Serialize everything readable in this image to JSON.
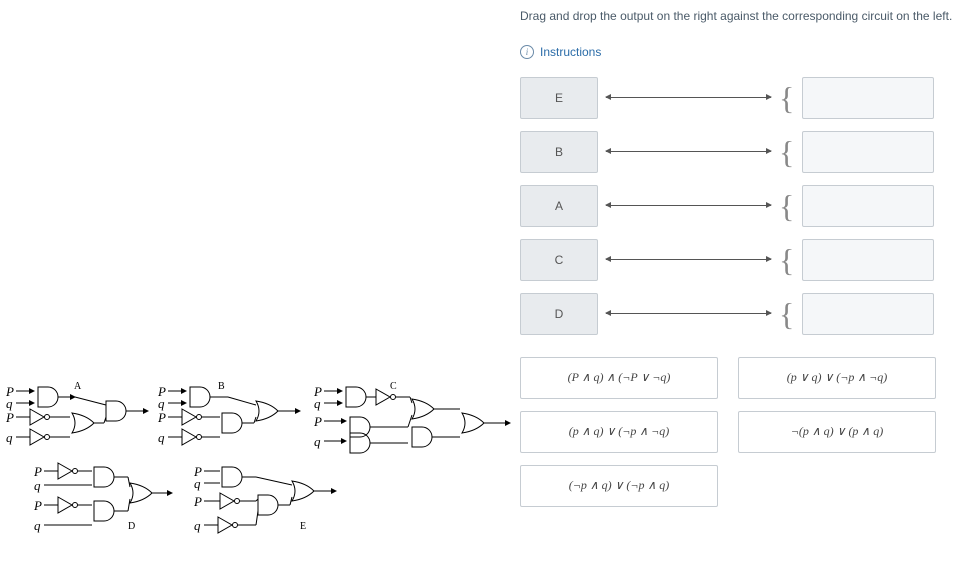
{
  "question_text": "Drag and drop the output on the right against the corresponding circuit on the left.",
  "instructions_label": "Instructions",
  "match_items": [
    "E",
    "B",
    "A",
    "C",
    "D"
  ],
  "answers": [
    "(P ∧ q) ∧ (¬P ∨ ¬q)",
    "(p ∨ q) ∨ (¬p ∧ ¬q)",
    "(p ∧ q) ∨ (¬p ∧ ¬q)",
    "¬(p ∧ q) ∨ (p ∧ q)",
    "(¬p ∧ q) ∨ (¬p ∧ q)"
  ],
  "circuit_labels": {
    "a": "A",
    "b": "B",
    "c": "C",
    "d": "D",
    "e": "E"
  },
  "vars": {
    "p": "P",
    "q": "q",
    "pl": "p"
  }
}
